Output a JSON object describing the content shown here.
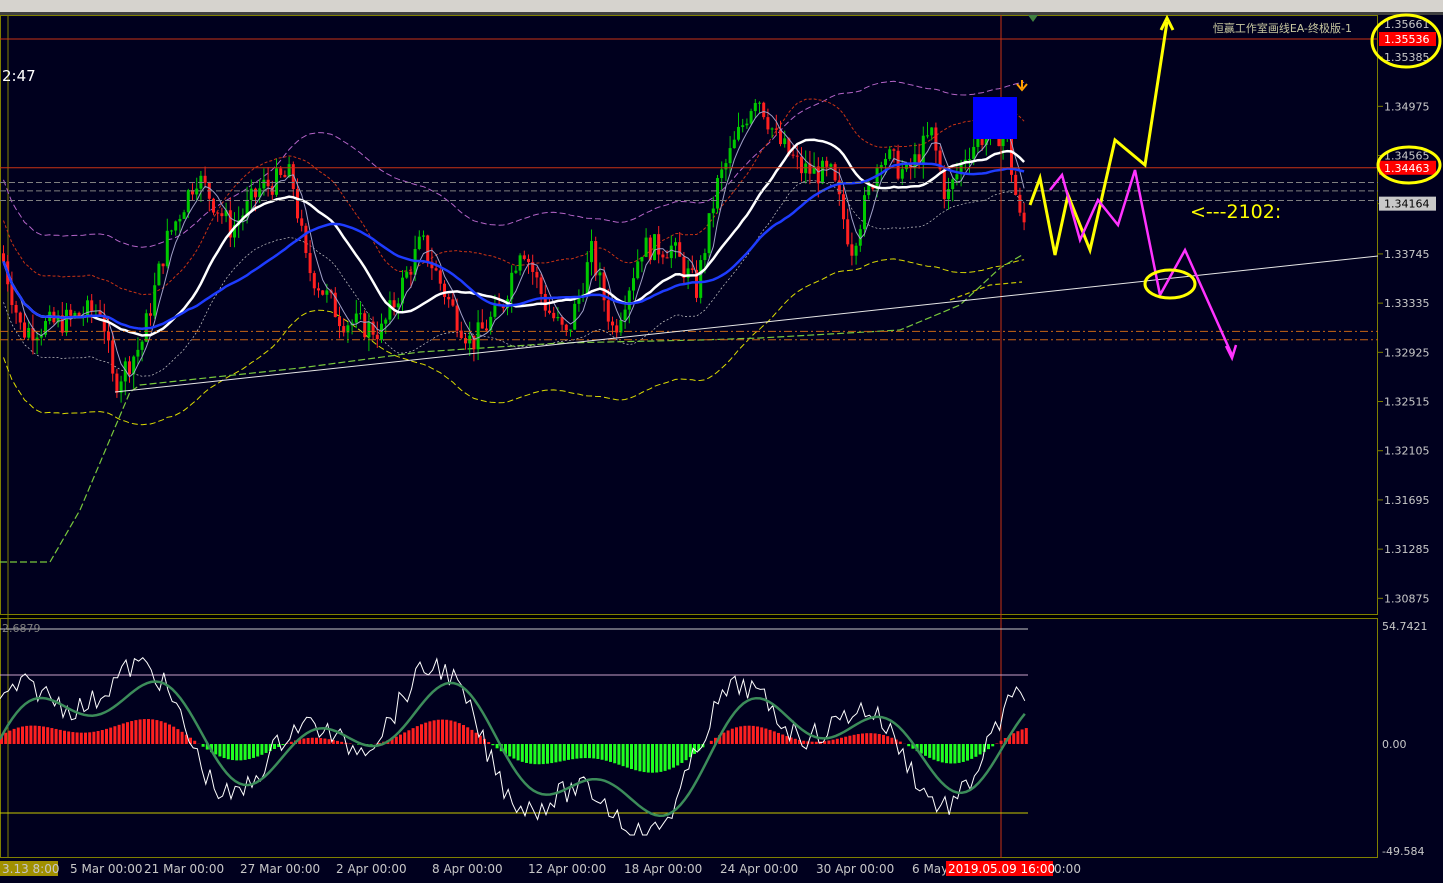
{
  "colors": {
    "background": "#00001e",
    "grid": "#808000",
    "bull": "#00c800",
    "bear": "#ff2020",
    "ma_white": "#ffffff",
    "ma_blue": "#1e3cff",
    "band_violet": "#b464c8",
    "band_red": "#c83214",
    "band_green": "#78c83c",
    "band_yellow": "#dcdc00",
    "arrow_yellow": "#ffff00",
    "arrow_magenta": "#ff33ff",
    "highlight_blue": "#0000ff",
    "label_red": "#ff0000"
  },
  "header": {
    "indicator_title": "恒赢工作室画线EA-终极版-1",
    "clock": "2:47"
  },
  "price_axis": {
    "ticks": [
      "1.35661",
      "1.35385",
      "1.34975",
      "1.34565",
      "1.34164",
      "1.33745",
      "1.33335",
      "1.32925",
      "1.32515",
      "1.32105",
      "1.31695",
      "1.31285",
      "1.30875"
    ],
    "label_top_red": "1.35536",
    "label_current_red": "1.34463",
    "label_current_gray": "1.34164"
  },
  "osc_axis": {
    "top": "54.7421",
    "zero": "0.00",
    "bottom": "-49.584",
    "left_value": "2.6879"
  },
  "annotation": {
    "text": "<---2102:"
  },
  "time_axis": {
    "labels": [
      "3.13 8:00",
      "5 Mar 00:00",
      "21 Mar 00:00",
      "27 Mar 00:00",
      "2 Apr 00:00",
      "8 Apr 00:00",
      "12 Apr 00:00",
      "18 Apr 00:00",
      "24 Apr 00:00",
      "30 Apr 00:00",
      "6 May",
      "2019.05.09 16:00",
      "0:00"
    ]
  },
  "chart_data": {
    "type": "candlestick",
    "symbol_timeframe": "",
    "ylim": [
      1.3066,
      1.3574
    ],
    "key_levels": [
      1.35536,
      1.34463,
      1.34164,
      1.331,
      1.3303
    ],
    "current_price": 1.34463,
    "oscillator": {
      "ylim": [
        -49.584,
        54.7421
      ],
      "levels": [
        30,
        -30,
        0
      ]
    }
  }
}
